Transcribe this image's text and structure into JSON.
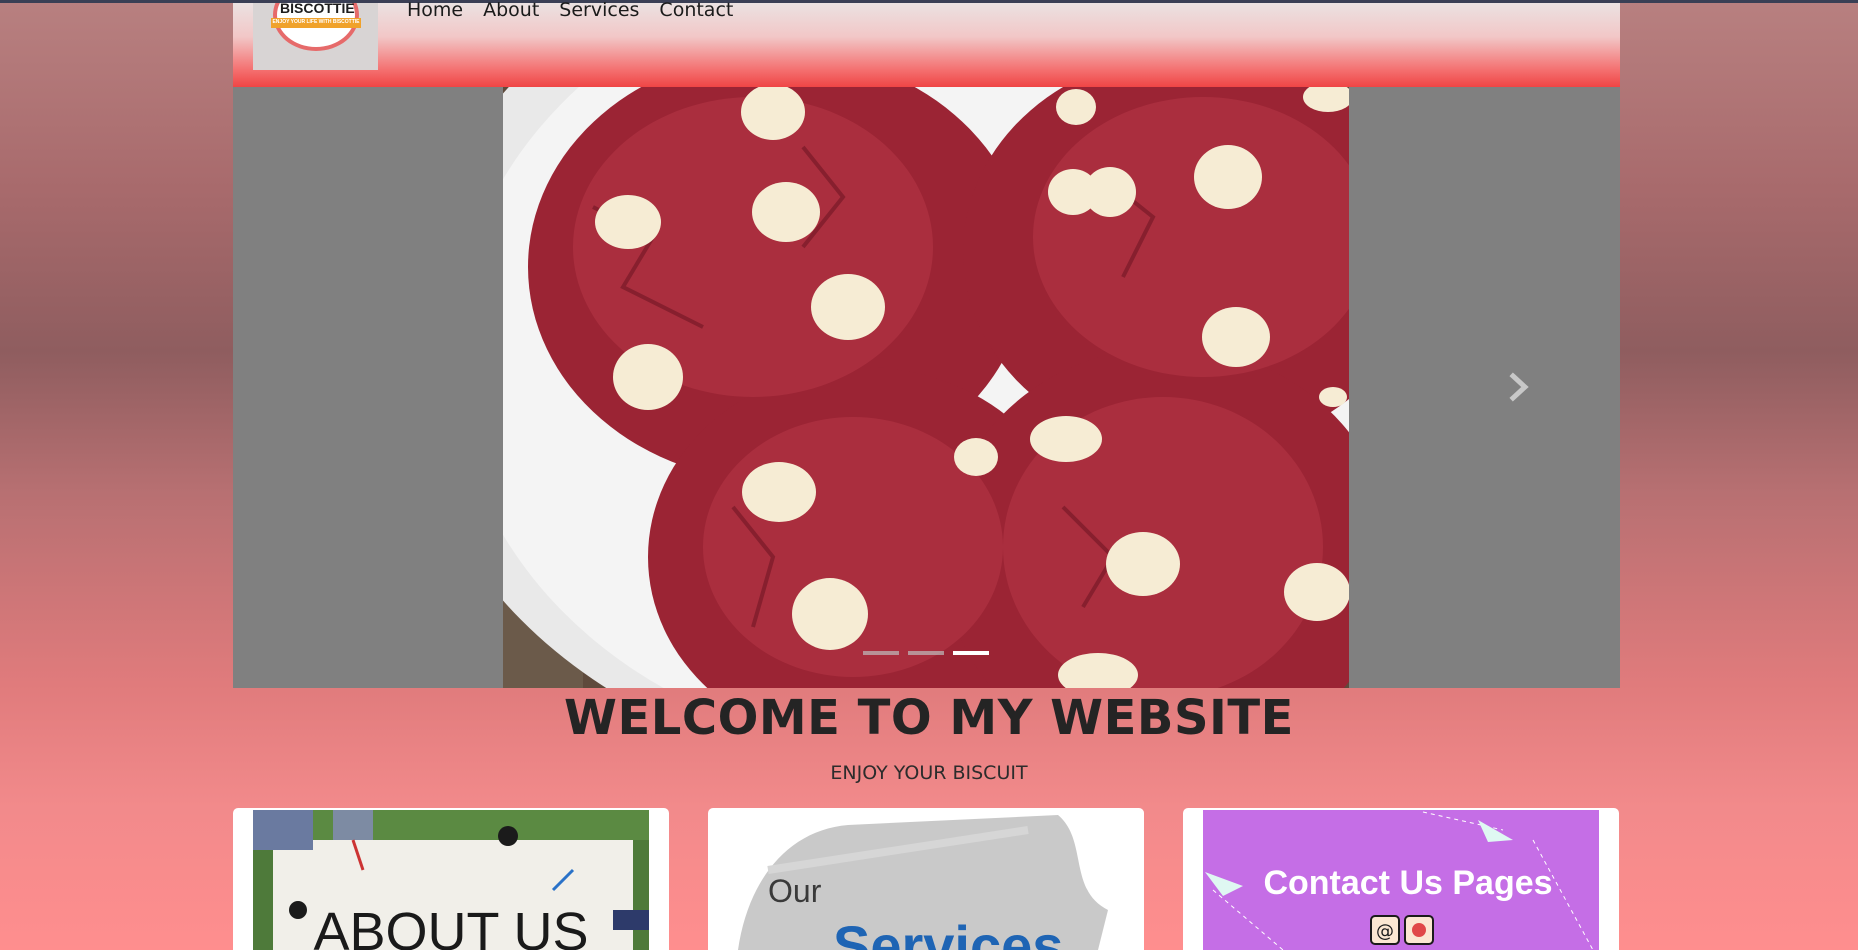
{
  "brand": {
    "logo_name": "BISCOTTIE",
    "logo_tagline": "ENJOY YOUR LIFE WITH BISCOTTIE"
  },
  "nav": {
    "items": [
      {
        "label": "Home"
      },
      {
        "label": "About"
      },
      {
        "label": "Services"
      },
      {
        "label": "Contact"
      }
    ]
  },
  "carousel": {
    "slide_count": 3,
    "active_index": 2,
    "next_icon": "chevron-right-icon"
  },
  "hero": {
    "title": "WELCOME TO MY WEBSITE",
    "subtitle": "ENJOY YOUR BISCUIT"
  },
  "cards": [
    {
      "image_text": "ABOUT US"
    },
    {
      "image_text_1": "Our",
      "image_text_2": "Services"
    },
    {
      "image_text": "Contact Us Pages"
    }
  ],
  "colors": {
    "nav_gradient_end": "#ef4545",
    "carousel_bg": "#808080",
    "contact_card_bg": "#c56ee6",
    "services_text_blue": "#1e64b4"
  }
}
